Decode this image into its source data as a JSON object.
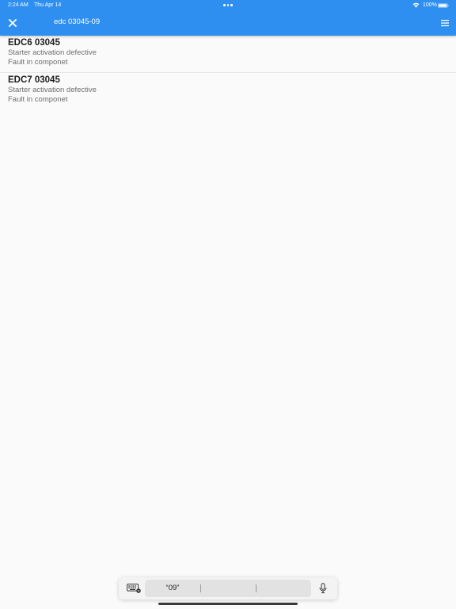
{
  "status_bar": {
    "time": "2:24 AM",
    "date": "Thu Apr 14",
    "battery": "100%",
    "wifi_icon": "wifi-icon",
    "battery_icon": "battery-full-icon"
  },
  "app_bar": {
    "close_icon": "close-icon",
    "search_query": "edc 03045-09",
    "menu_icon": "hamburger-menu-icon",
    "color": "#2f8ff0"
  },
  "results": [
    {
      "code": "EDC6 03045",
      "description": "Starter activation defective",
      "status": "Fault in componet"
    },
    {
      "code": "EDC7 03045",
      "description": "Starter activation defective",
      "status": "Fault in componet"
    }
  ],
  "keyboard_bar": {
    "keyboard_icon": "keyboard-icon",
    "suggestions": [
      "“09”",
      "",
      ""
    ],
    "mic_icon": "microphone-icon"
  }
}
